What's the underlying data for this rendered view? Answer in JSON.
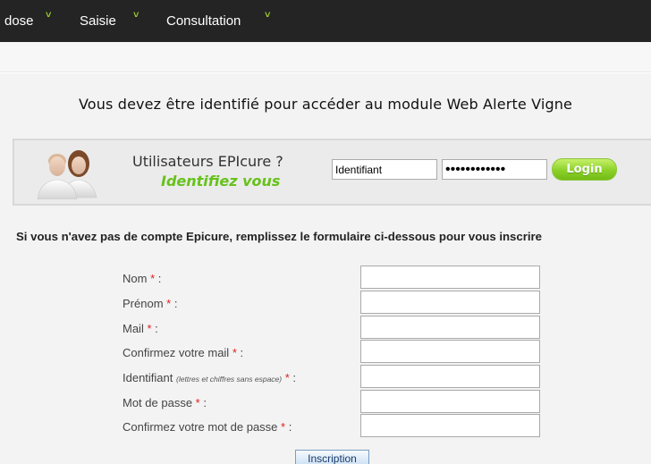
{
  "nav": {
    "items": [
      {
        "label": "dose"
      },
      {
        "label": "Saisie"
      },
      {
        "label": "Consultation"
      }
    ],
    "chevron": "˅"
  },
  "heading": "Vous devez être identifié pour accéder au module Web Alerte Vigne",
  "login": {
    "question": "Utilisateurs EPIcure ?",
    "cta": "Identifiez vous",
    "username_value": "Identifiant",
    "password_value": "••••••••••••",
    "button_label": "Login",
    "button_color": "#8bd12a"
  },
  "register": {
    "intro": "Si vous n'avez pas de compte Epicure, remplissez le formulaire ci-dessous pour vous inscrire",
    "required_mark": "*",
    "required_color": "#e02020",
    "fields": [
      {
        "label": "Nom",
        "suffix": " :",
        "hint": "",
        "value": ""
      },
      {
        "label": "Prénom",
        "suffix": " :",
        "hint": "",
        "value": ""
      },
      {
        "label": "Mail",
        "suffix": " :",
        "hint": "",
        "value": ""
      },
      {
        "label": "Confirmez votre mail",
        "suffix": " :",
        "hint": "",
        "value": ""
      },
      {
        "label": "Identifiant",
        "suffix": " :",
        "hint": "(lettres et chiffres sans espace)",
        "value": ""
      },
      {
        "label": "Mot de passe",
        "suffix": " :",
        "hint": "",
        "value": ""
      },
      {
        "label": "Confirmez votre mot de passe",
        "suffix": " :",
        "hint": "",
        "value": ""
      }
    ],
    "submit_label": "Inscription"
  },
  "icons": {
    "avatars": "users-icon"
  }
}
